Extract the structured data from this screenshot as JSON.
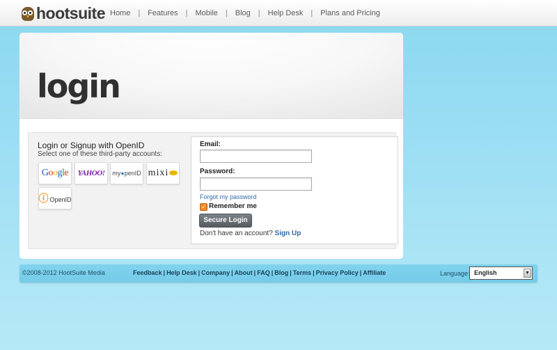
{
  "header": {
    "logo_text": "hootsuite",
    "nav": [
      {
        "label": "Home"
      },
      {
        "label": "Features"
      },
      {
        "label": "Mobile"
      },
      {
        "label": "Blog"
      },
      {
        "label": "Help Desk"
      },
      {
        "label": "Plans and Pricing"
      }
    ],
    "separator": "|"
  },
  "login": {
    "title": "login",
    "openid": {
      "title": "Login or Signup with OpenID",
      "subtitle": "Select one of these third-party accounts:",
      "providers": [
        {
          "name": "Google",
          "icon": "google-logo"
        },
        {
          "name": "YAHOO!",
          "icon": "yahoo-logo"
        },
        {
          "name": "myOpenID",
          "icon": "myopenid-logo"
        },
        {
          "name": "mixi",
          "icon": "mixi-logo"
        },
        {
          "name": "OpenID",
          "icon": "openid-logo"
        }
      ]
    },
    "form": {
      "email_label": "Email:",
      "email_value": "",
      "password_label": "Password:",
      "password_value": "",
      "forgot_link": "Forgot my password",
      "remember_label": "Remember me",
      "remember_checked": true,
      "submit_label": "Secure Login",
      "no_account_text": "Don't have an account?",
      "signup_link": "Sign Up"
    }
  },
  "footer": {
    "copyright": "©2008-2012 HootSuite Media",
    "links": [
      {
        "label": "Feedback"
      },
      {
        "label": "Help Desk"
      },
      {
        "label": "Company"
      },
      {
        "label": "About"
      },
      {
        "label": "FAQ"
      },
      {
        "label": "Blog"
      },
      {
        "label": "Terms"
      },
      {
        "label": "Privacy Policy"
      },
      {
        "label": "Affiliate"
      }
    ],
    "language_label": "Language:",
    "language_value": "English"
  },
  "colors": {
    "background": "#8fd9f1",
    "accent_link": "#2f68a8",
    "button": "#5f666b",
    "checkbox": "#f08a28"
  }
}
